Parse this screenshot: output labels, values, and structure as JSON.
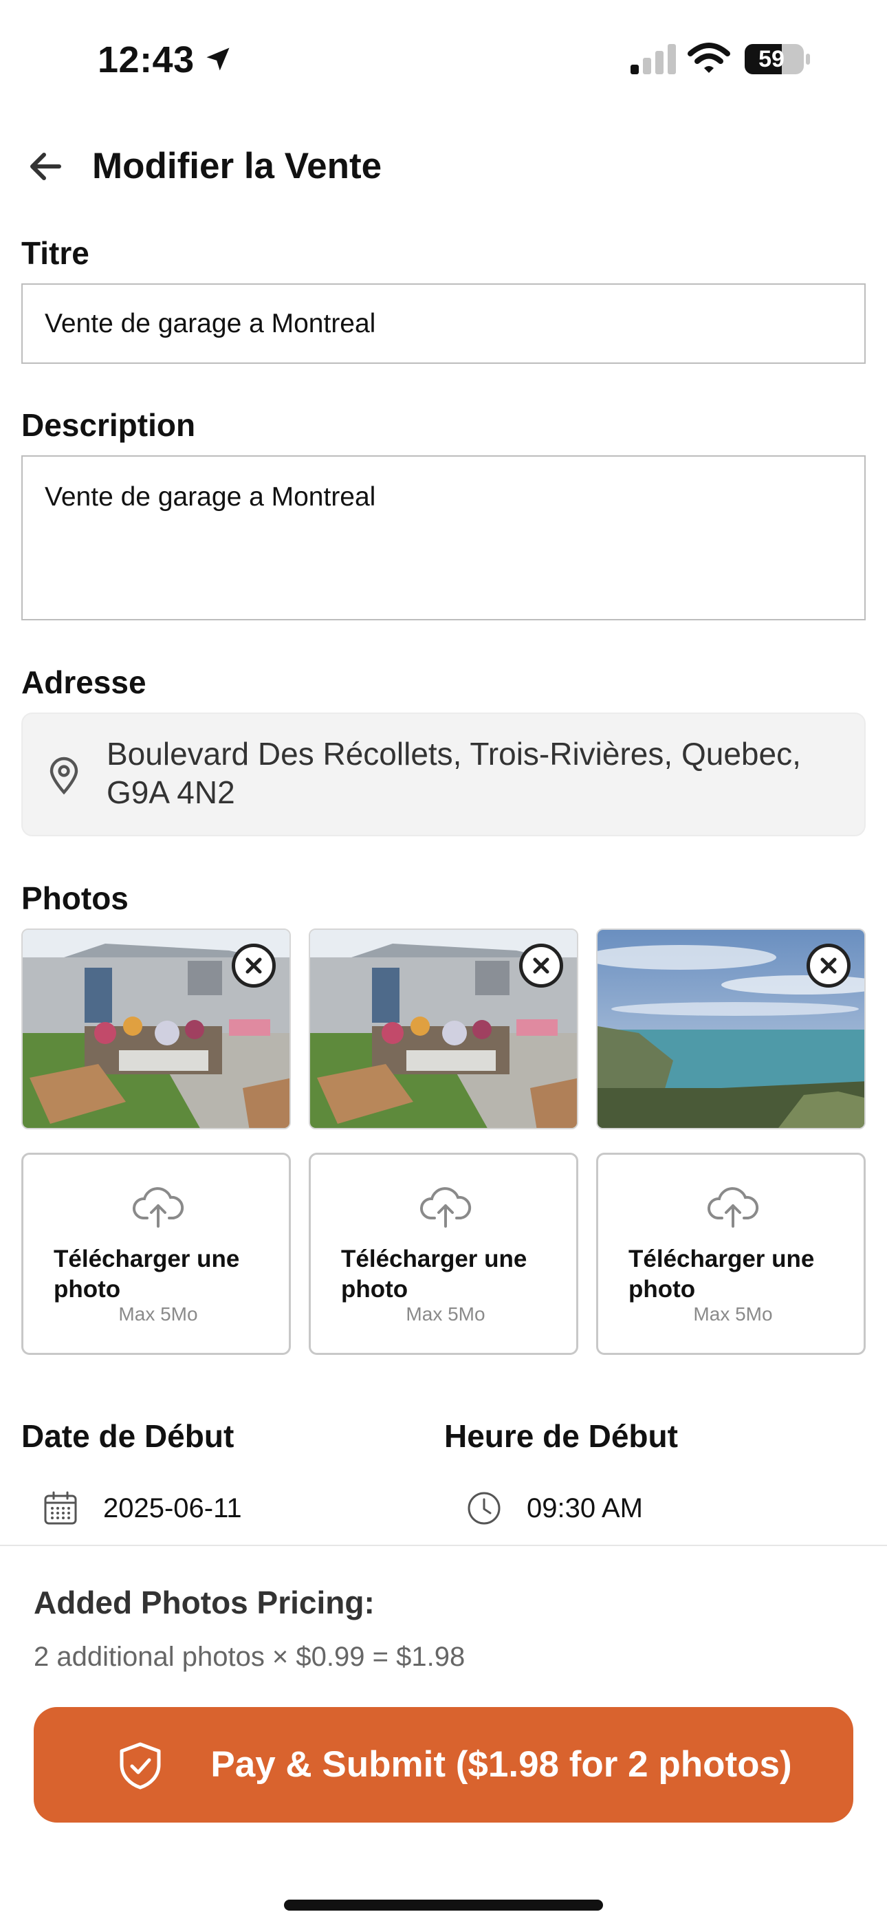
{
  "status_bar": {
    "time": "12:43",
    "battery": "59"
  },
  "header": {
    "title": "Modifier la Vente"
  },
  "form": {
    "title_label": "Titre",
    "title_value": "Vente de garage a Montreal",
    "description_label": "Description",
    "description_value": "Vente de garage a Montreal",
    "address_label": "Adresse",
    "address_value": "Boulevard Des Récollets, Trois-Rivières, Quebec, G9A 4N2",
    "photos_label": "Photos",
    "photos": [
      {
        "scene": "garage-sale"
      },
      {
        "scene": "garage-sale"
      },
      {
        "scene": "ocean-coast"
      }
    ],
    "upload_tiles": [
      {
        "label": "Télécharger une photo",
        "max": "Max 5Mo"
      },
      {
        "label": "Télécharger une photo",
        "max": "Max 5Mo"
      },
      {
        "label": "Télécharger une photo",
        "max": "Max 5Mo"
      }
    ],
    "start_date_label": "Date de Début",
    "start_date_value": "2025-06-11",
    "start_time_label": "Heure de Début",
    "start_time_value": "09:30 AM"
  },
  "pricing": {
    "title": "Added Photos Pricing:",
    "detail": "2 additional photos × $0.99 = $1.98",
    "pay_label": "Pay & Submit ($1.98 for 2 photos)"
  },
  "colors": {
    "accent": "#d9632e",
    "input_border": "#bdbdbd",
    "address_bg": "#f3f3f3"
  }
}
